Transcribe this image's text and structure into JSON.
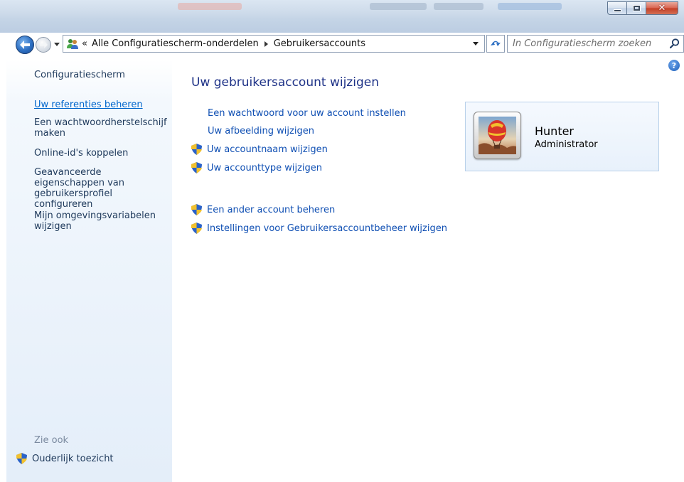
{
  "window": {
    "minimize_icon": "minimize-icon",
    "maximize_icon": "maximize-icon",
    "close_icon": "close-icon"
  },
  "nav": {
    "back_icon": "back-arrow-icon",
    "forward_icon": "forward-arrow-icon",
    "address_icon": "users-icon",
    "overflow_chevron": "«",
    "breadcrumb": [
      "Alle Configuratiescherm-onderdelen",
      "Gebruikersaccounts"
    ],
    "refresh_icon": "refresh-icon",
    "search_placeholder": "In Configuratiescherm zoeken",
    "search_icon": "search-icon"
  },
  "sidebar": {
    "title": "Configuratiescherm",
    "links": [
      "Uw referenties beheren",
      "Een wachtwoordherstelschijf maken",
      "Online-id's koppelen",
      "Geavanceerde eigenschappen van gebruikersprofiel configureren",
      "Mijn omgevingsvariabelen wijzigen"
    ],
    "see_also": "Zie ook",
    "parental_control": "Ouderlijk toezicht"
  },
  "main": {
    "title": "Uw gebruikersaccount wijzigen",
    "tasks": [
      {
        "label": "Een wachtwoord voor uw account instellen",
        "shield": false
      },
      {
        "label": "Uw afbeelding wijzigen",
        "shield": false
      },
      {
        "label": "Uw accountnaam wijzigen",
        "shield": true
      },
      {
        "label": "Uw accounttype wijzigen",
        "shield": true
      }
    ],
    "other_tasks": [
      {
        "label": "Een ander account beheren",
        "shield": true
      },
      {
        "label": "Instellingen voor Gebruikersaccountbeheer wijzigen",
        "shield": true
      }
    ]
  },
  "user": {
    "name": "Hunter",
    "role": "Administrator",
    "avatar_icon": "hot-air-balloon-avatar"
  },
  "help_icon": "help-icon",
  "colors": {
    "link": "#0f4fb3",
    "heading": "#1e3287",
    "sidebar_text": "#1e395b",
    "active_link": "#0066cc"
  }
}
